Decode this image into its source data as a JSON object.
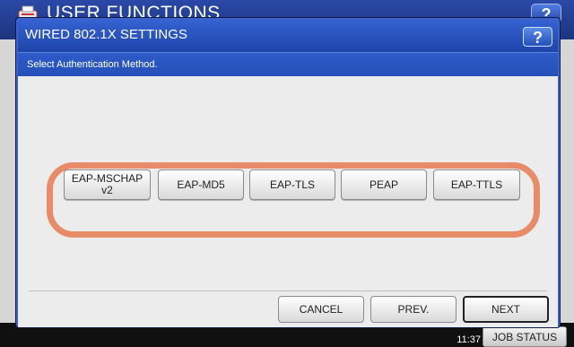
{
  "background": {
    "title": "USER FUNCTIONS",
    "help_label": "?",
    "time": "11:37",
    "date_fragment": "",
    "job_status_label": "JOB STATUS"
  },
  "dialog": {
    "title": "WIRED 802.1X SETTINGS",
    "help_label": "?",
    "instruction": "Select Authentication Method.",
    "methods": [
      {
        "label": "EAP-MSCHAP\nv2"
      },
      {
        "label": "EAP-MD5"
      },
      {
        "label": "EAP-TLS"
      },
      {
        "label": "PEAP"
      },
      {
        "label": "EAP-TTLS"
      }
    ],
    "footer": {
      "cancel_label": "CANCEL",
      "prev_label": "PREV.",
      "next_label": "NEXT"
    }
  },
  "colors": {
    "title_bar": "#1e44a8",
    "highlight_ring": "#e88b68",
    "body_bg": "#ececec"
  },
  "icons": {
    "app_icon": "printer-icon",
    "help_icon": "help-icon"
  }
}
